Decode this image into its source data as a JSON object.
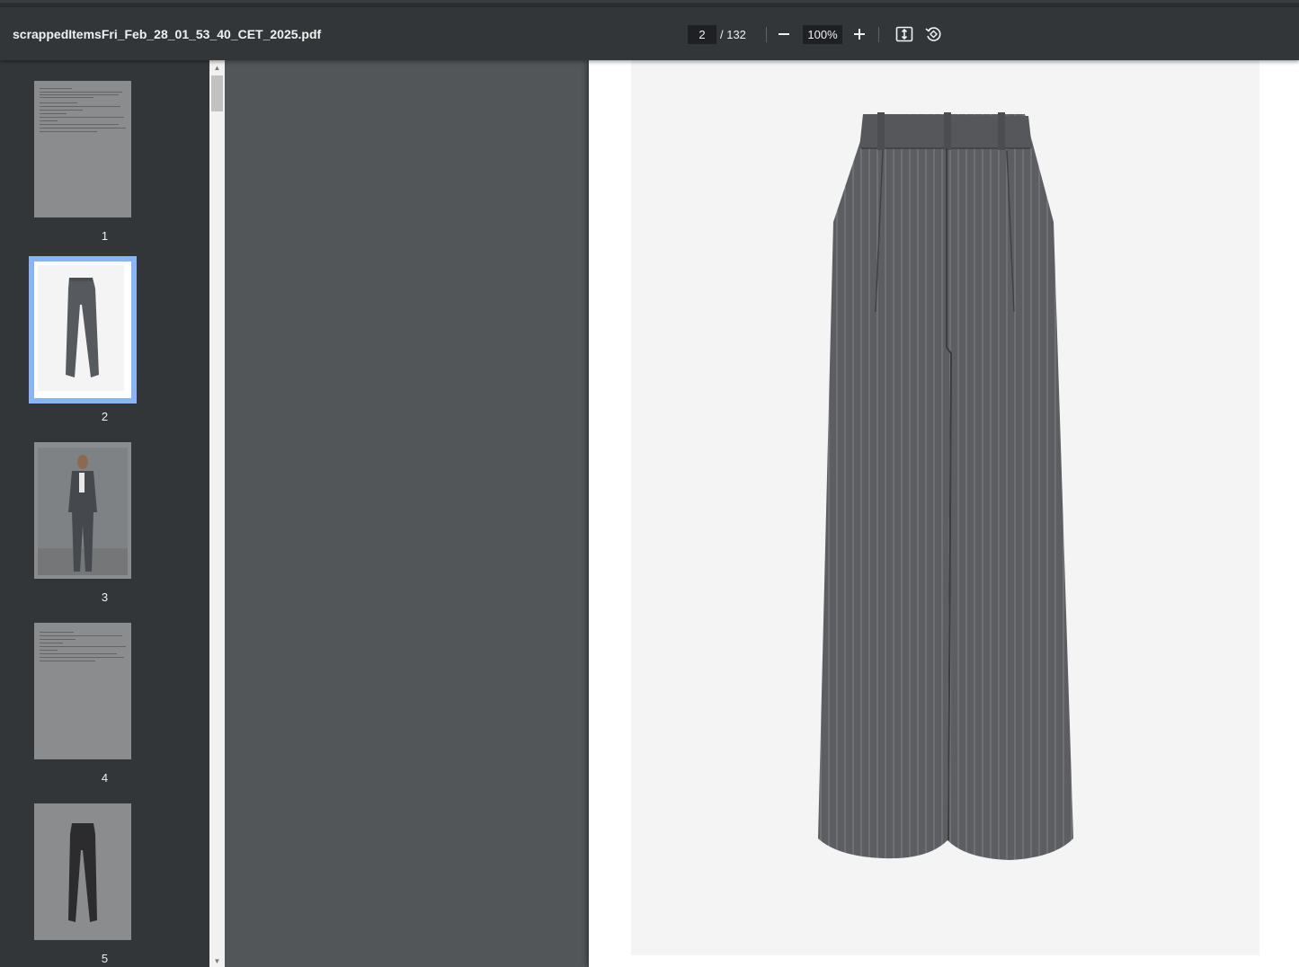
{
  "document": {
    "filename": "scrappedItemsFri_Feb_28_01_53_40_CET_2025.pdf"
  },
  "toolbar": {
    "current_page": "2",
    "page_total": "/ 132",
    "zoom": "100%",
    "icons": [
      "minus-icon",
      "plus-icon",
      "fit-page-icon",
      "rotate-icon"
    ]
  },
  "thumbnails": [
    {
      "label": "1",
      "content": "text"
    },
    {
      "label": "2",
      "content": "trousers",
      "selected": true
    },
    {
      "label": "3",
      "content": "model"
    },
    {
      "label": "4",
      "content": "text"
    },
    {
      "label": "5",
      "content": "dark-trousers"
    }
  ],
  "colors": {
    "toolbar_bg": "#323639",
    "viewer_bg": "#525659",
    "selected_border": "#8ab4f8",
    "fabric": "#5a5c60"
  }
}
